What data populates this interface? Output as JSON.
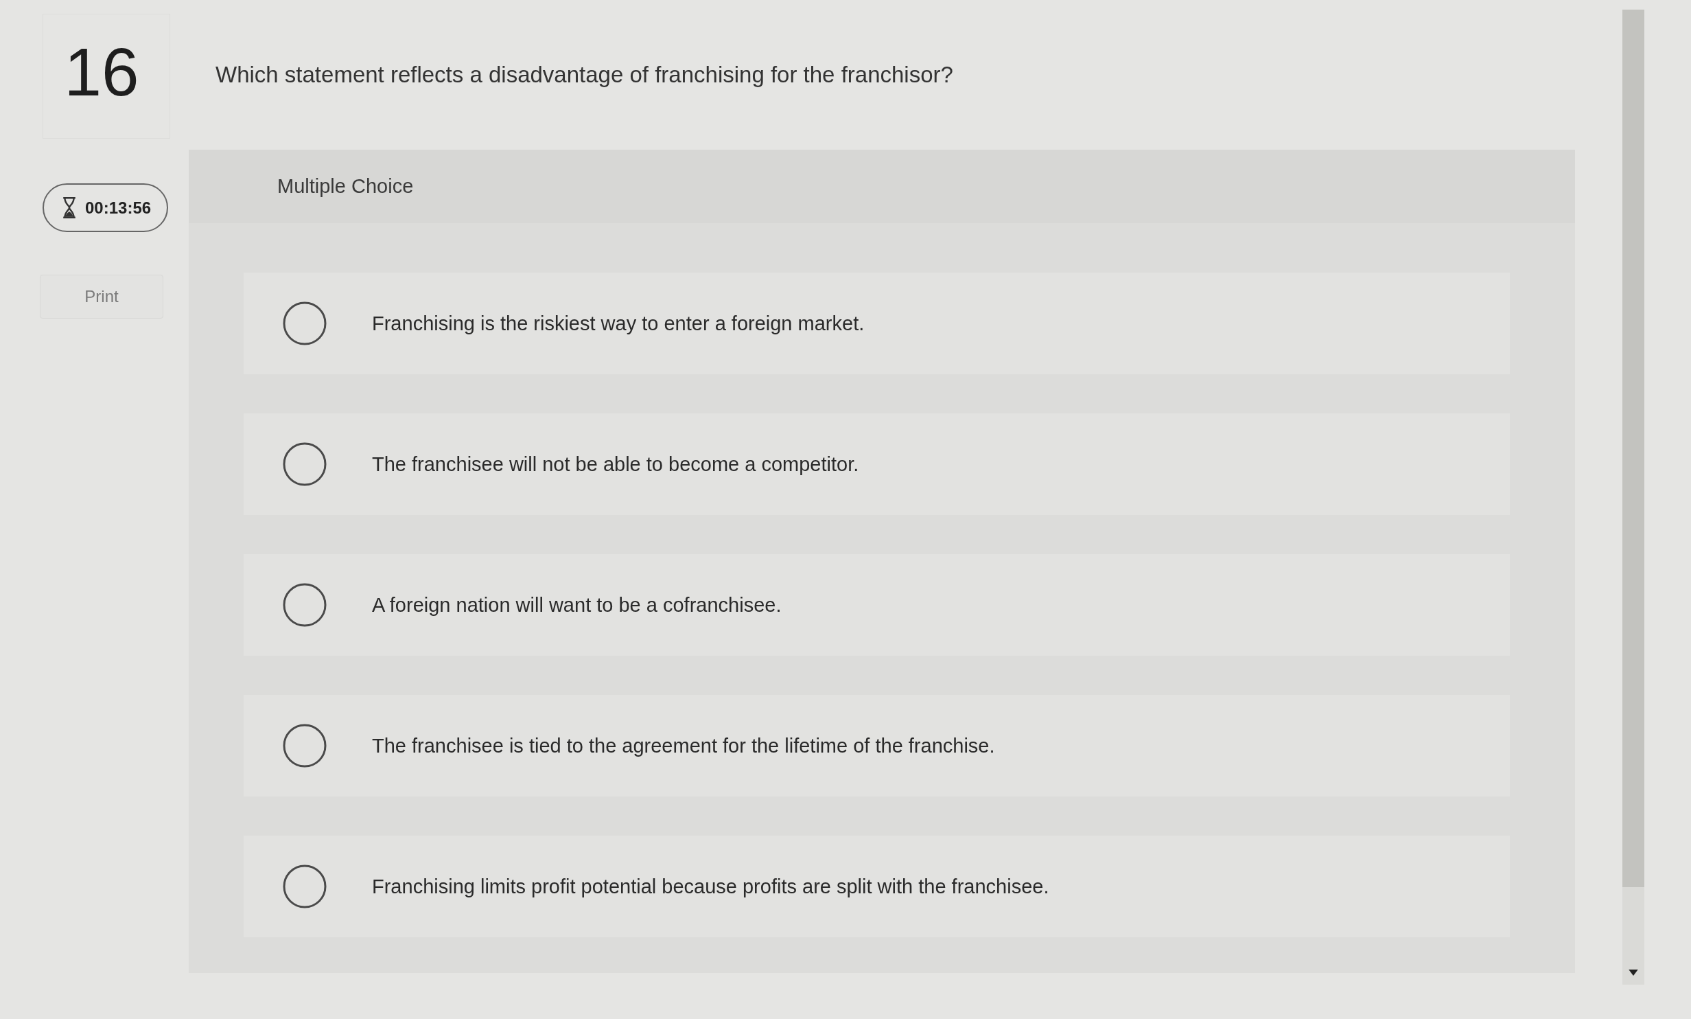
{
  "question": {
    "number": "16",
    "text": "Which statement reflects a disadvantage of franchising for the franchisor?"
  },
  "timer": {
    "time": "00:13:56"
  },
  "print_button": {
    "label": "Print"
  },
  "answer_panel": {
    "type_label": "Multiple Choice",
    "options": [
      {
        "text": "Franchising is the riskiest way to enter a foreign market.",
        "selected": false
      },
      {
        "text": "The franchisee will not be able to become a competitor.",
        "selected": false
      },
      {
        "text": "A foreign nation will want to be a cofranchisee.",
        "selected": false
      },
      {
        "text": "The franchisee is tied to the agreement for the lifetime of the franchise.",
        "selected": false
      },
      {
        "text": "Franchising limits profit potential because profits are split with the franchisee.",
        "selected": false
      }
    ]
  }
}
